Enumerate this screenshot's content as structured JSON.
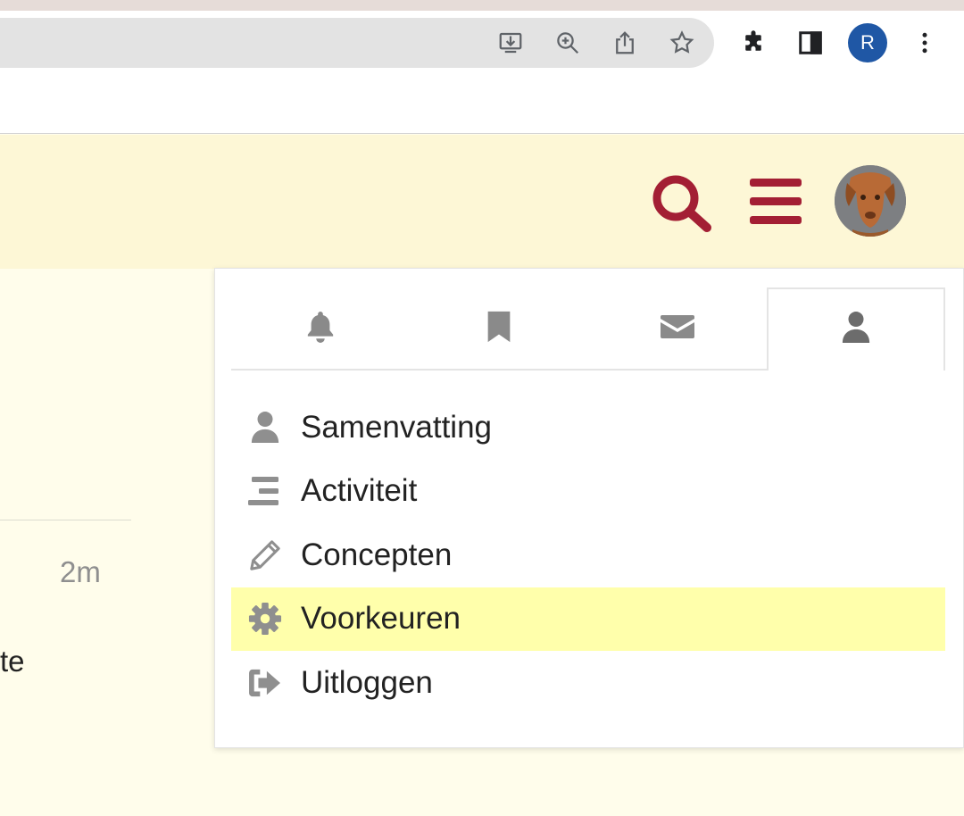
{
  "browser": {
    "profile_initial": "R",
    "profile_color": "#1f57a5",
    "toolbar_icons": [
      "install-icon",
      "zoom-icon",
      "share-icon",
      "bookmark-star-icon",
      "extensions-icon",
      "side-panel-icon",
      "kebab-menu-icon"
    ]
  },
  "header": {
    "accent_color": "#a31f34",
    "icons": [
      "search-icon",
      "hamburger-menu-icon",
      "user-avatar"
    ]
  },
  "background": {
    "time": "2m",
    "text_fragment": "te"
  },
  "user_menu": {
    "tabs": [
      {
        "name": "notifications",
        "icon": "bell-icon"
      },
      {
        "name": "bookmarks",
        "icon": "bookmark-icon"
      },
      {
        "name": "messages",
        "icon": "envelope-icon"
      },
      {
        "name": "profile",
        "icon": "user-icon",
        "active": true
      }
    ],
    "items": [
      {
        "label": "Samenvatting",
        "icon": "user-icon"
      },
      {
        "label": "Activiteit",
        "icon": "stream-icon"
      },
      {
        "label": "Concepten",
        "icon": "pencil-icon"
      },
      {
        "label": "Voorkeuren",
        "icon": "gear-icon",
        "highlighted": true
      },
      {
        "label": "Uitloggen",
        "icon": "sign-out-icon"
      }
    ],
    "highlight_color": "#ffffab"
  }
}
